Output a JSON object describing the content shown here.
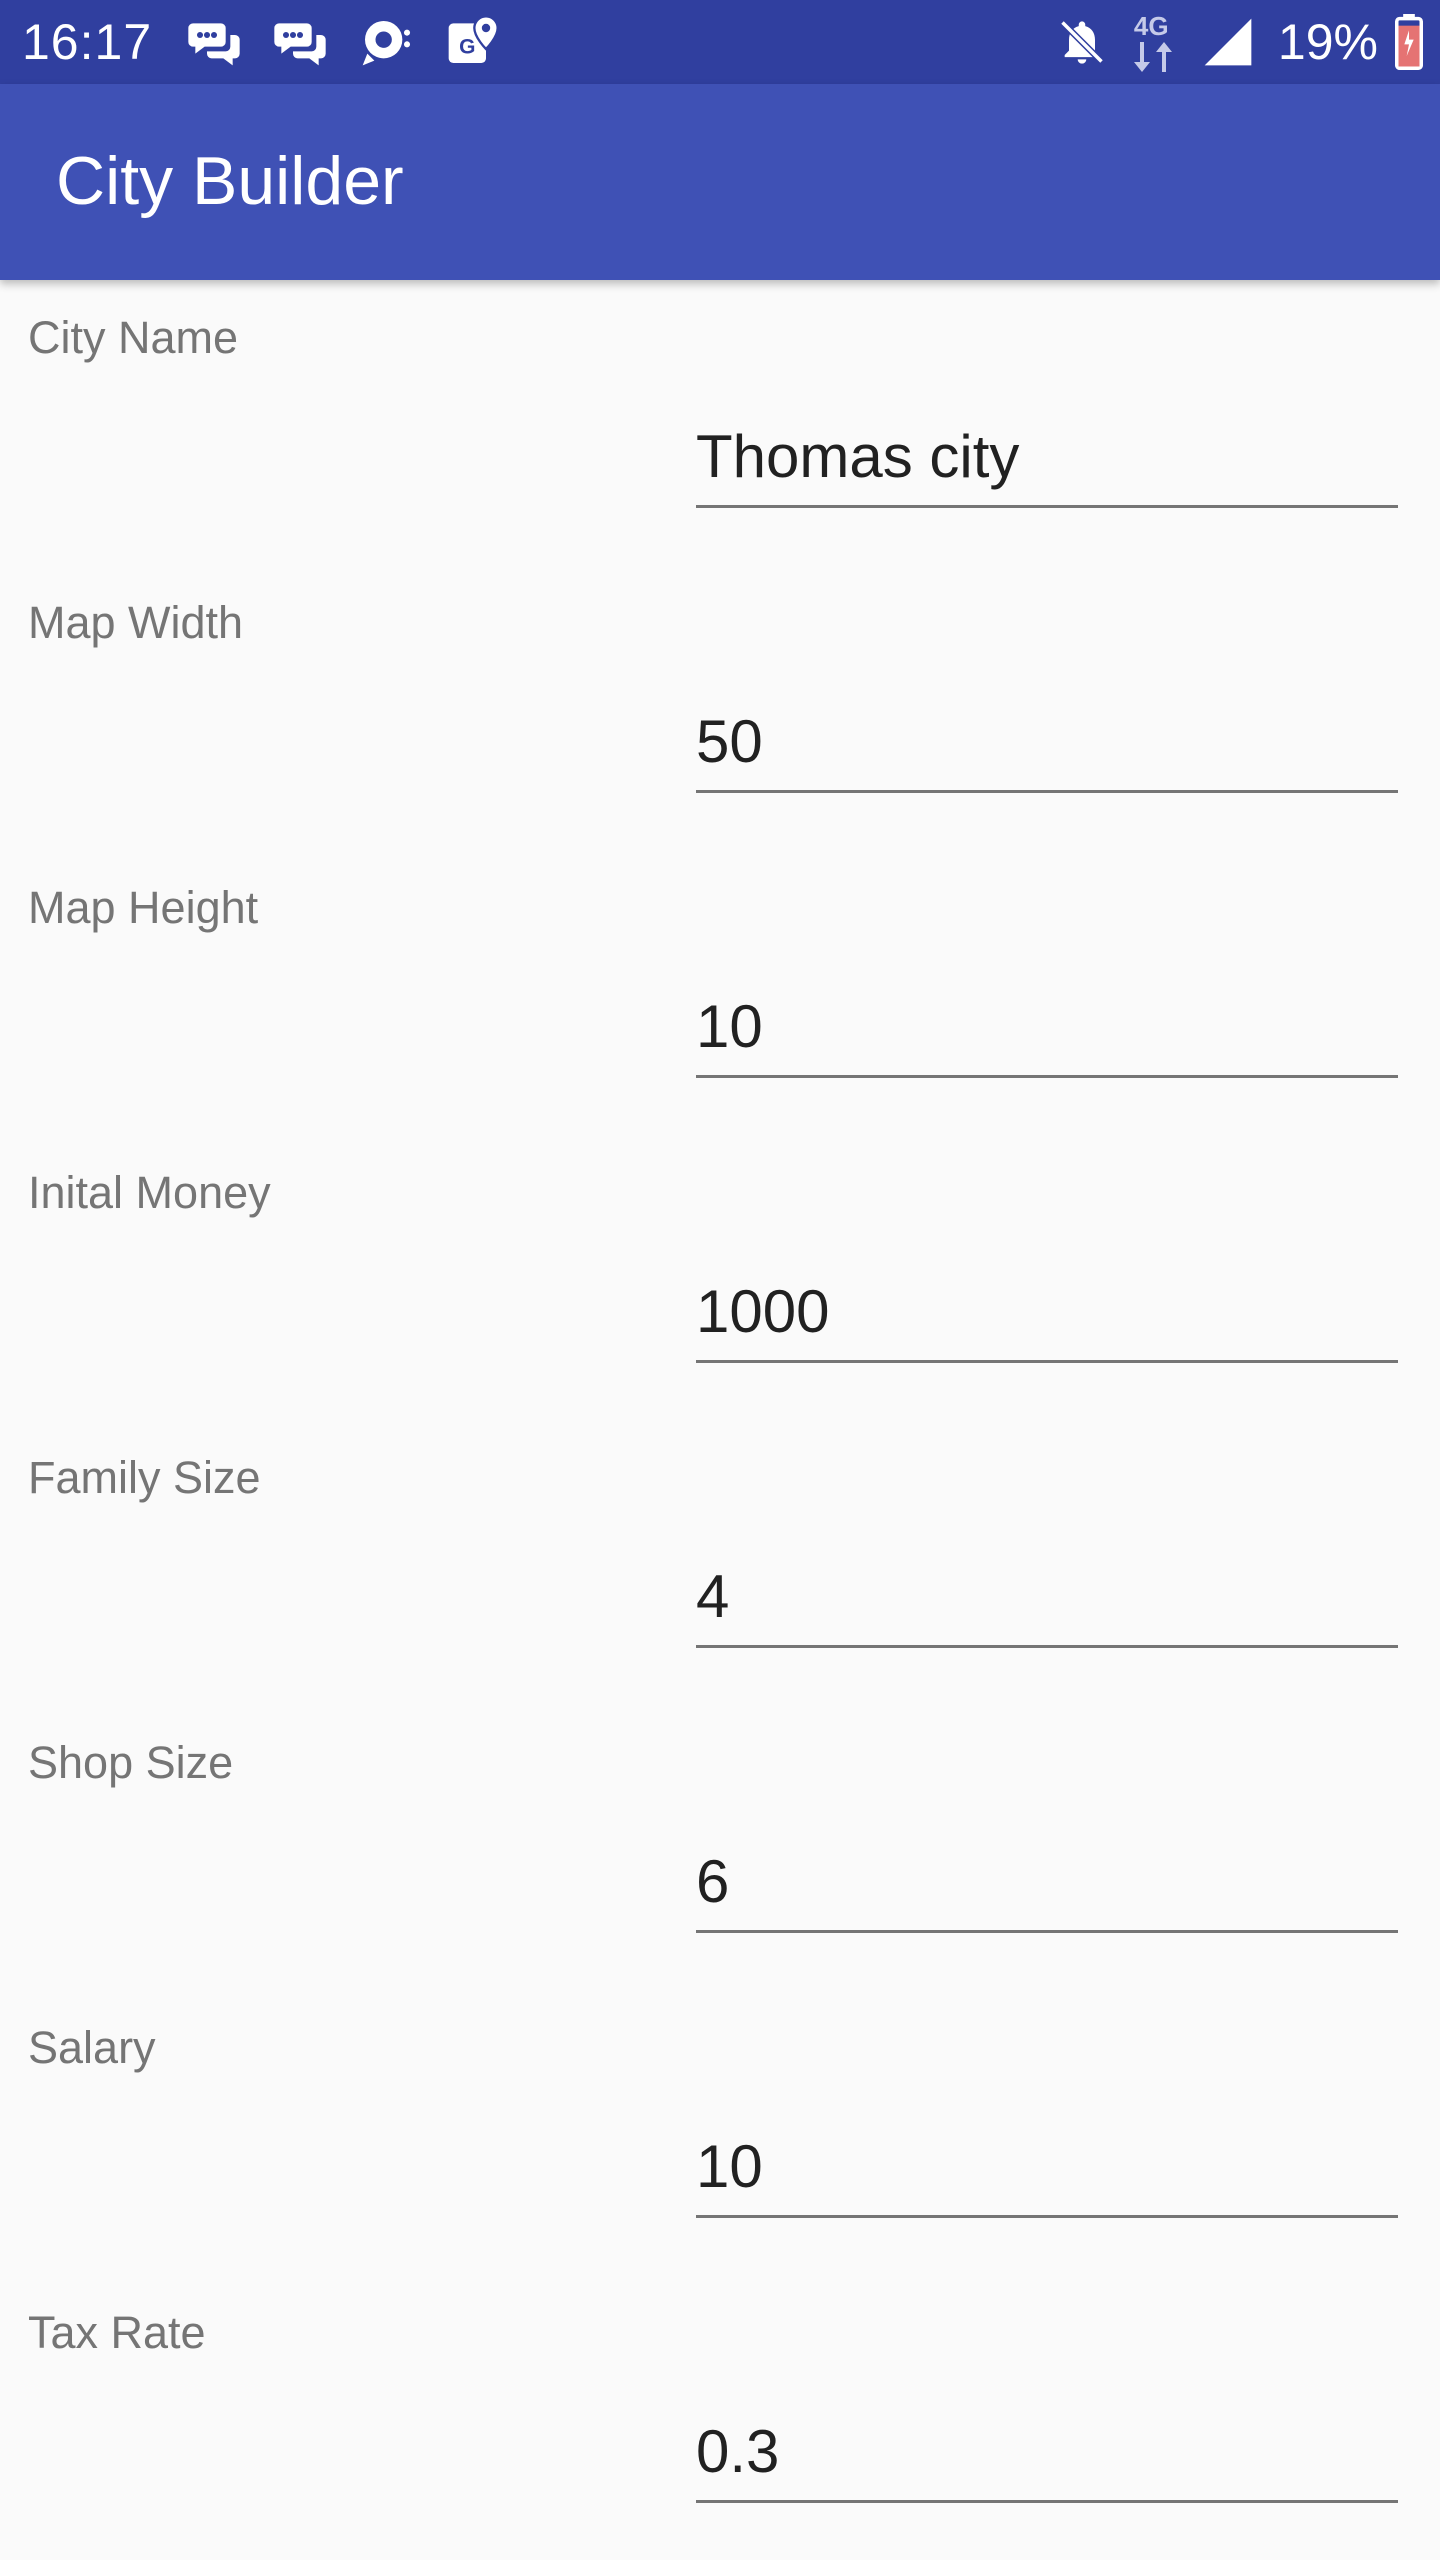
{
  "status_bar": {
    "time": "16:17",
    "network": "4G",
    "battery": "19%",
    "left_icons": [
      "chat-bubbles-icon",
      "chat-bubbles-icon",
      "sync-icon",
      "maps-icon"
    ],
    "right_icons": [
      "notifications-off-icon",
      "data-arrows-icon",
      "signal-icon",
      "battery-charging-icon"
    ],
    "colors": {
      "background": "#303f9f"
    }
  },
  "app_bar": {
    "title": "City Builder",
    "colors": {
      "background": "#3f51b5"
    }
  },
  "form": {
    "fields": [
      {
        "label": "City Name",
        "value": "Thomas city"
      },
      {
        "label": "Map Width",
        "value": "50"
      },
      {
        "label": "Map Height",
        "value": "10"
      },
      {
        "label": "Inital Money",
        "value": "1000"
      },
      {
        "label": "Family Size",
        "value": "4"
      },
      {
        "label": "Shop Size",
        "value": "6"
      },
      {
        "label": "Salary",
        "value": "10"
      },
      {
        "label": "Tax Rate",
        "value": "0.3"
      }
    ]
  }
}
